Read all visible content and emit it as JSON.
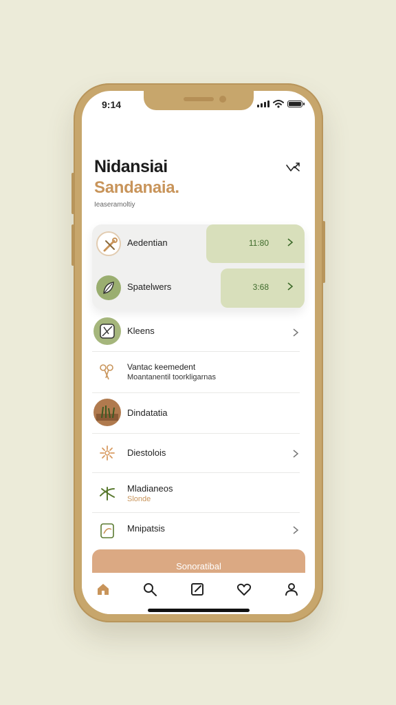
{
  "status_bar": {
    "time": "9:14"
  },
  "header": {
    "title": "Nidansiai",
    "subtitle": "Sandanaia.",
    "caption": "Ieaseramoltiy"
  },
  "summary_card": {
    "rows": [
      {
        "label": "Aedentian",
        "value": "11:80",
        "icon": "tools-icon",
        "fill_fraction": 0.46
      },
      {
        "label": "Spatelwers",
        "value": "3:68",
        "icon": "leaf-icon",
        "fill_fraction": 0.39
      }
    ]
  },
  "list": [
    {
      "label": "Kleens",
      "sub": "",
      "icon": "plant-badge-icon",
      "chevron": true
    },
    {
      "label": "Vantac keemedent",
      "sub": "Moantanentil toorkligarnas",
      "icon": "scissors-icon",
      "chevron": false
    },
    {
      "label": "Dindatatia",
      "sub": "",
      "icon": "grass-photo-icon",
      "chevron": false
    },
    {
      "label": "Diestolois",
      "sub": "",
      "icon": "flower-icon",
      "chevron": true
    },
    {
      "label": "Mladianeos",
      "sub": "Slonde",
      "icon": "sprout-icon",
      "chevron": false
    },
    {
      "label": "Mnipatsis",
      "sub": "",
      "icon": "seed-packet-icon",
      "chevron": true
    }
  ],
  "cta": {
    "label": "Sonoratibal"
  },
  "tabbar": {
    "items": [
      "home-icon",
      "search-icon",
      "edit-icon",
      "heart-icon",
      "profile-icon"
    ]
  },
  "colors": {
    "background": "#ecebd9",
    "phone_frame": "#c7a66c",
    "accent_orange": "#c8945a",
    "accent_green": "#8fa563",
    "card_fill": "#d8dfbb",
    "cta": "#dba983"
  }
}
